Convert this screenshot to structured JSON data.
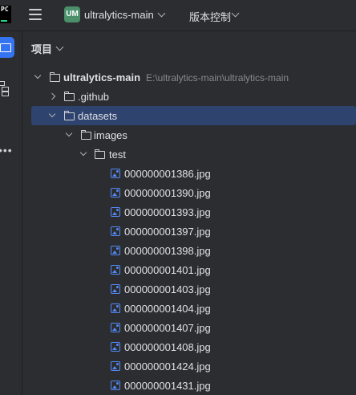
{
  "titlebar": {
    "app_logo": "PC",
    "menu_icon": "hamburger-icon",
    "project_badge": "UM",
    "project_name": "ultralytics-main",
    "vcs_label": "版本控制"
  },
  "sidebar": {
    "items": [
      "project-icon",
      "structure-icon",
      "more-icon"
    ]
  },
  "panel": {
    "title": "项目"
  },
  "tree": {
    "root": {
      "name": "ultralytics-main",
      "path": "E:\\ultralytics-main\\ultralytics-main"
    },
    "github": ".github",
    "datasets": "datasets",
    "images": "images",
    "test": "test",
    "files": [
      "000000001386.jpg",
      "000000001390.jpg",
      "000000001393.jpg",
      "000000001397.jpg",
      "000000001398.jpg",
      "000000001401.jpg",
      "000000001403.jpg",
      "000000001404.jpg",
      "000000001407.jpg",
      "000000001408.jpg",
      "000000001424.jpg",
      "000000001431.jpg"
    ]
  },
  "colors": {
    "background": "#2b2d30",
    "selection": "#2e436e",
    "accent": "#3574f0",
    "badge": "#4b8f6b"
  }
}
